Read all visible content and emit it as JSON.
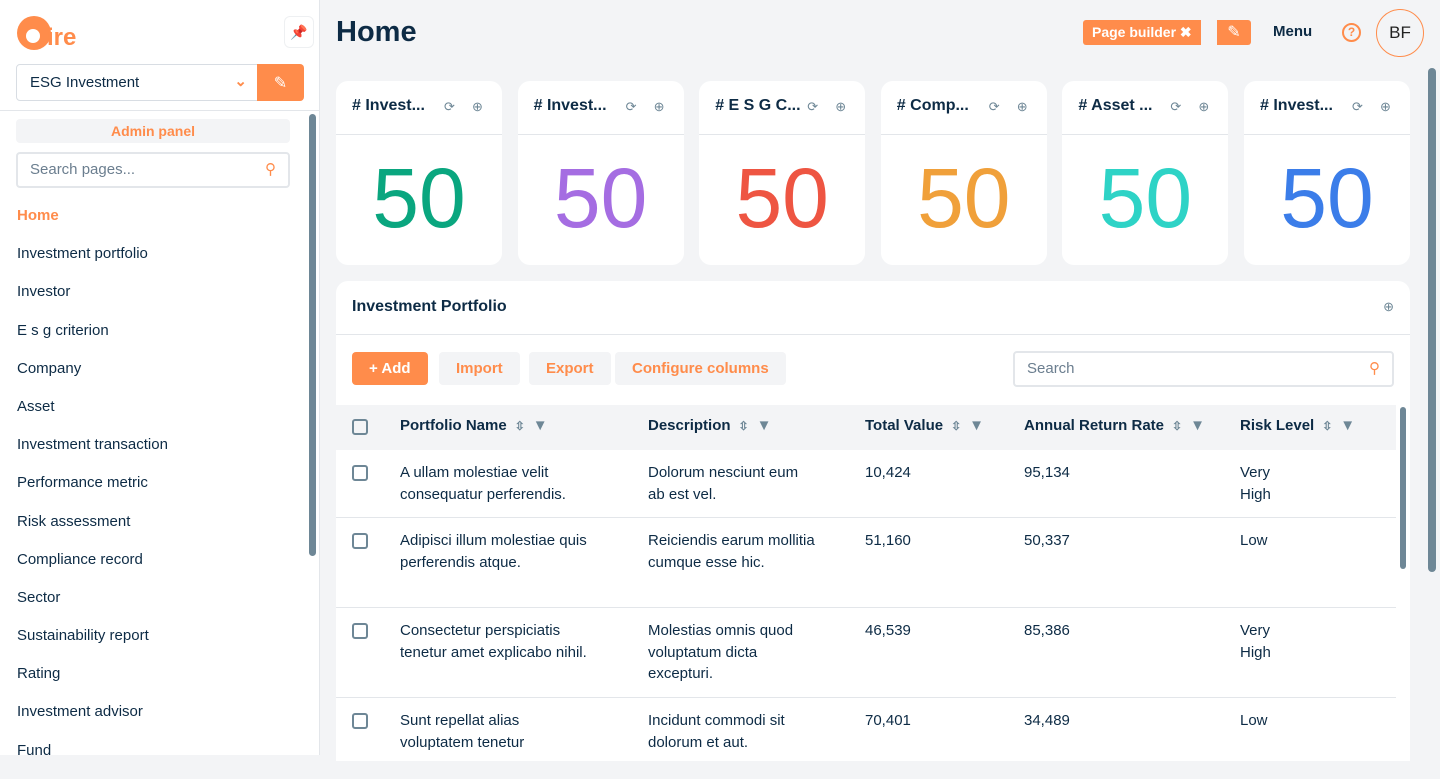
{
  "sidebar": {
    "logo_text": "aire",
    "app_select": "ESG Investment",
    "admin_panel": "Admin panel",
    "search_placeholder": "Search pages...",
    "items": [
      "Home",
      "Investment portfolio",
      "Investor",
      "E s g criterion",
      "Company",
      "Asset",
      "Investment transaction",
      "Performance metric",
      "Risk assessment",
      "Compliance record",
      "Sector",
      "Sustainability report",
      "Rating",
      "Investment advisor",
      "Fund"
    ]
  },
  "header": {
    "title": "Home",
    "page_builder": "Page builder",
    "menu": "Menu",
    "help": "?",
    "avatar": "BF"
  },
  "cards": [
    {
      "title": "# Invest...",
      "value": "50",
      "color": "#0aa67f"
    },
    {
      "title": "# Invest...",
      "value": "50",
      "color": "#a56de2"
    },
    {
      "title": "# E S G C...",
      "value": "50",
      "color": "#ee5542"
    },
    {
      "title": "# Comp...",
      "value": "50",
      "color": "#f0a03a"
    },
    {
      "title": "# Asset ...",
      "value": "50",
      "color": "#2ed3c6"
    },
    {
      "title": "# Invest...",
      "value": "50",
      "color": "#3b7de9"
    }
  ],
  "table": {
    "title": "Investment Portfolio",
    "buttons": {
      "add": "+ Add",
      "import": "Import",
      "export": "Export",
      "configure": "Configure columns"
    },
    "search_placeholder": "Search",
    "columns": [
      "Portfolio Name",
      "Description",
      "Total Value",
      "Annual Return Rate",
      "Risk Level"
    ],
    "rows": [
      [
        "A ullam molestiae velit consequatur perferendis.",
        "Dolorum nesciunt eum ab est vel.",
        "10,424",
        "95,134",
        "Very High"
      ],
      [
        "Adipisci illum molestiae quis perferendis atque.",
        "Reiciendis earum mollitia cumque esse hic.",
        "51,160",
        "50,337",
        "Low"
      ],
      [
        "Consectetur perspiciatis tenetur amet explicabo nihil.",
        "Molestias omnis quod voluptatum dicta excepturi.",
        "46,539",
        "85,386",
        "Very High"
      ],
      [
        "Sunt repellat alias voluptatem tenetur",
        "Incidunt commodi sit dolorum et aut.",
        "70,401",
        "34,489",
        "Low"
      ]
    ]
  }
}
